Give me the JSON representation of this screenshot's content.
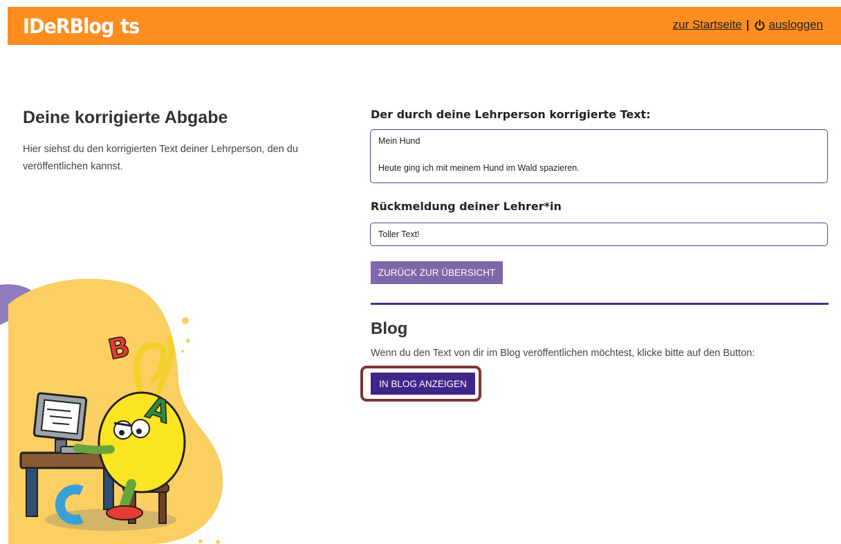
{
  "header": {
    "logo_main": "IDeRBlog",
    "logo_suffix": "ts",
    "home_link": "zur Startseite",
    "separator": "|",
    "logout_link": "ausloggen",
    "bar_color": "#fd8d1f"
  },
  "intro": {
    "title": "Deine korrigierte Abgabe",
    "description": "Hier siehst du den korrigierten Text deiner Lehrperson, den du veröffentlichen kannst."
  },
  "corrected_text": {
    "label": "Der durch deine Lehrperson korrigierte Text:",
    "title": "Mein Hund",
    "body": "Heute ging ich mit meinem Hund im Wald spazieren."
  },
  "feedback": {
    "label": "Rückmeldung deiner Lehrer*in",
    "text": "Toller Text!"
  },
  "back_button": "ZURÜCK ZUR ÜBERSICHT",
  "blog": {
    "title": "Blog",
    "description": "Wenn du den Text von dir im Blog veröffentlichen möchtest, klicke bitte auf den Button:",
    "button": "IN BLOG ANZEIGEN"
  },
  "colors": {
    "accent_purple": "#3f2588",
    "muted_purple": "#7d68a8",
    "highlight_border": "#7b3434"
  },
  "icons": [
    "power-icon",
    "monster-illustration"
  ]
}
